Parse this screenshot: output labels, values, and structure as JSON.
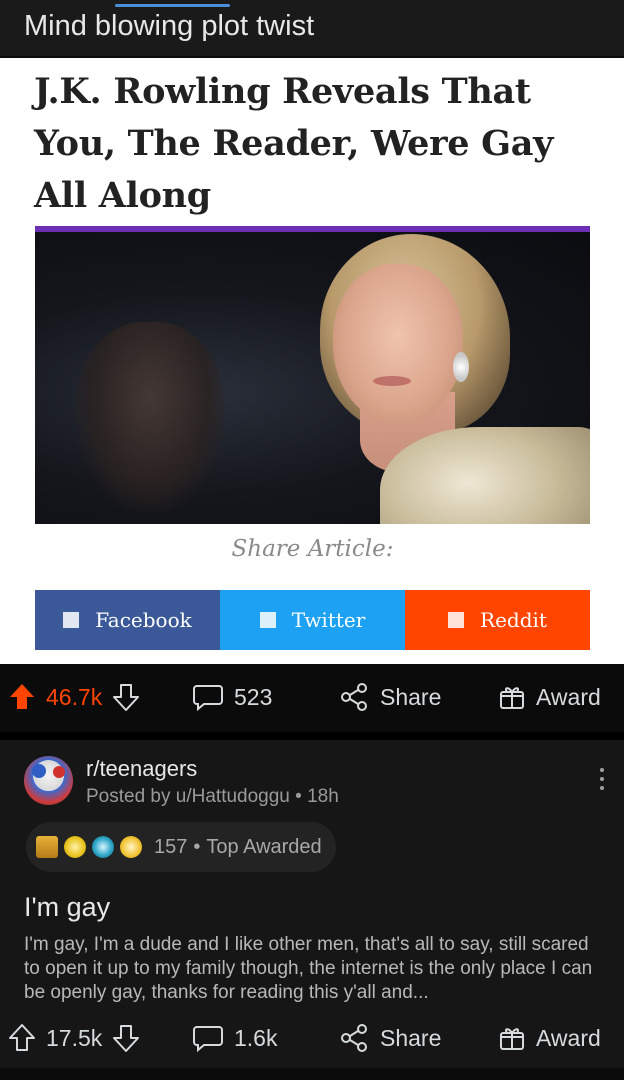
{
  "header": {
    "title": "Mind blowing plot twist"
  },
  "article": {
    "headline": "J.K. Rowling Reveals That You, The Reader, Were Gay All Along",
    "share_label": "Share Article:",
    "share_buttons": [
      {
        "label": "Facebook",
        "color": "#3b5998"
      },
      {
        "label": "Twitter",
        "color": "#1da1f2"
      },
      {
        "label": "Reddit",
        "color": "#ff4500"
      }
    ]
  },
  "post_actions": {
    "score": "46.7k",
    "score_state": "upvoted",
    "comments": "523",
    "share_label": "Share",
    "award_label": "Award"
  },
  "crosspost": {
    "subreddit": "r/teenagers",
    "posted_by": "Posted by u/Hattudoggu",
    "age": "18h",
    "awards": {
      "icons": [
        "gold-bars-award-icon",
        "party-hat-award-icon",
        "globe-award-icon",
        "star-award-icon"
      ],
      "count": "157",
      "label": "Top Awarded"
    },
    "title": "I'm gay",
    "body": "I'm gay, I'm a dude and I like other men, that's all to say, still scared to open it up to my family though, the internet is the only place I can be openly gay, thanks for reading this y'all and...",
    "score": "17.5k",
    "comments": "1.6k",
    "share_label": "Share",
    "award_label": "Award"
  },
  "colors": {
    "upvote_active": "#ff4500",
    "background": "#0b0b0b",
    "card": "#161617"
  }
}
